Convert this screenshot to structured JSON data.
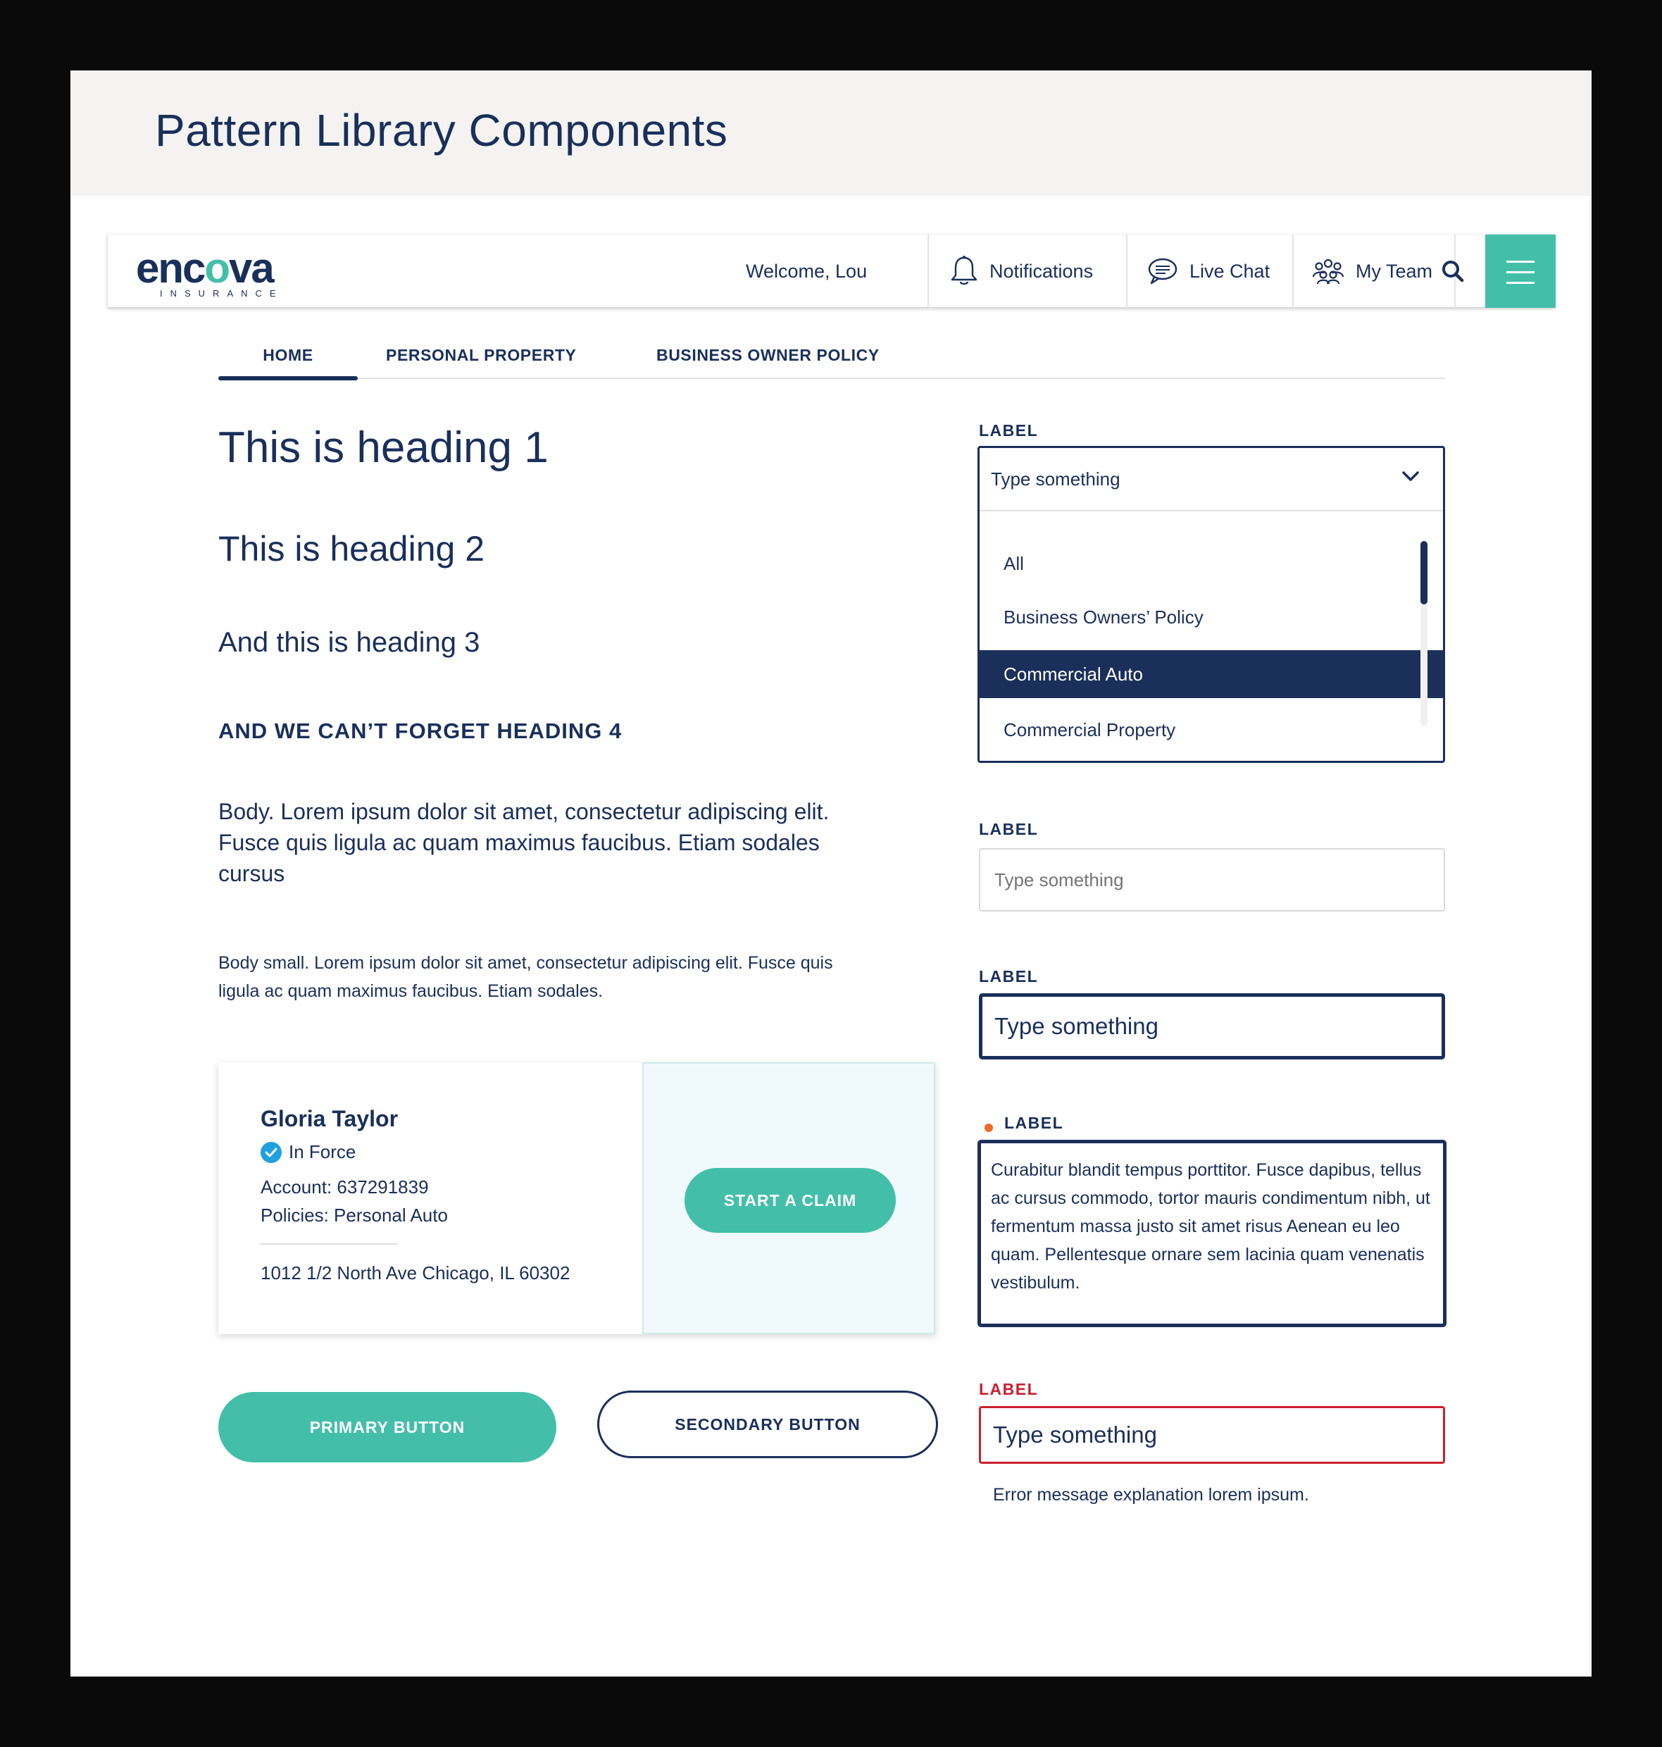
{
  "page": {
    "title": "Pattern Library Components"
  },
  "header": {
    "logo_text_1": "enc",
    "logo_text_2": "o",
    "logo_text_3": "va",
    "logo_sub": "INSURANCE",
    "welcome": "Welcome, Lou",
    "notifications": "Notifications",
    "live_chat": "Live Chat",
    "my_team": "My Team"
  },
  "tabs": [
    {
      "label": "HOME",
      "active": true
    },
    {
      "label": "PERSONAL PROPERTY",
      "active": false
    },
    {
      "label": "BUSINESS OWNER POLICY",
      "active": false
    }
  ],
  "typography": {
    "h1": "This is heading 1",
    "h2": "This is heading 2",
    "h3": "And this is heading 3",
    "h4": "AND WE CAN’T FORGET HEADING 4",
    "body": "Body. Lorem ipsum dolor sit amet, consectetur adipiscing elit. Fusce quis ligula ac quam maximus faucibus. Etiam sodales cursus",
    "body_small": "Body small. Lorem ipsum dolor sit amet, consectetur adipiscing elit. Fusce quis ligula ac quam maximus faucibus. Etiam sodales."
  },
  "card": {
    "name": "Gloria Taylor",
    "status": "In Force",
    "account": "Account: 637291839",
    "policies": "Policies: Personal Auto",
    "address": "1012 1/2 North Ave Chicago, IL 60302",
    "action": "START A CLAIM"
  },
  "buttons": {
    "primary": "PRIMARY BUTTON",
    "secondary": "SECONDARY BUTTON"
  },
  "form": {
    "dropdown": {
      "label": "LABEL",
      "value": "Type something",
      "options": [
        "All",
        "Business Owners’ Policy",
        "Commercial Auto",
        "Commercial Property"
      ],
      "selected": "Commercial Auto"
    },
    "input_default": {
      "label": "LABEL",
      "placeholder": "Type something"
    },
    "input_focus": {
      "label": "LABEL",
      "value": "Type something"
    },
    "textarea": {
      "label": "LABEL",
      "value": "Curabitur blandit tempus porttitor. Fusce dapibus, tellus ac cursus commodo, tortor mauris condimentum nibh, ut fermentum massa justo sit amet risus Aenean eu leo quam. Pellentesque ornare sem lacinia quam venenatis vestibulum."
    },
    "input_error": {
      "label": "LABEL",
      "value": "Type something",
      "error": "Error message explanation lorem ipsum."
    }
  },
  "colors": {
    "navy": "#1a2f5a",
    "teal": "#43bfa9",
    "error": "#cc1f2f",
    "required": "#ef6a2b",
    "check": "#1fa0de"
  }
}
